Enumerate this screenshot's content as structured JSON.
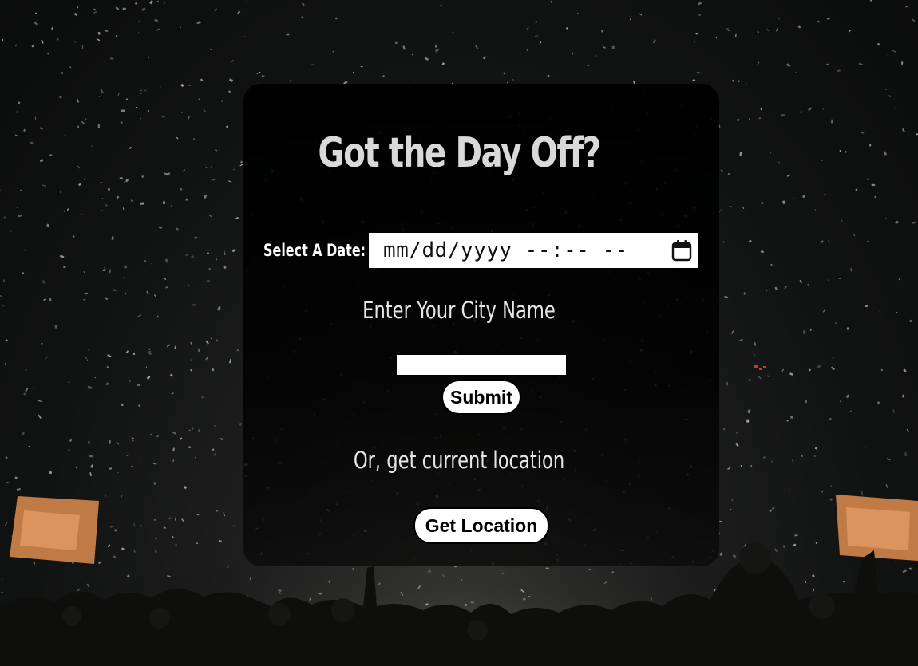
{
  "title": "Got the Day Off?",
  "date": {
    "label": "Select A Date:",
    "placeholder": "mm/dd/yyyy --:-- --"
  },
  "city": {
    "heading": "Enter Your City Name",
    "value": "",
    "submit_label": "Submit"
  },
  "location": {
    "heading": "Or, get current location",
    "button_label": "Get Location"
  },
  "icons": {
    "calendar": "calendar-icon"
  },
  "colors": {
    "card_background": "#000000",
    "title_text": "#d9d9d9",
    "body_text": "#e6e6e6",
    "button_background": "#ffffff",
    "button_border": "#000000"
  }
}
